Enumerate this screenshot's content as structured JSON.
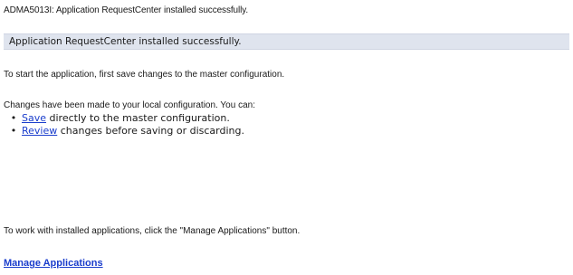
{
  "message_code_line": "ADMA5013I: Application RequestCenter installed successfully.",
  "status_banner": "Application RequestCenter installed successfully.",
  "instruction": "To start the application, first save changes to the master configuration.",
  "changes_intro": "Changes have been made to your local configuration. You can:",
  "options": [
    {
      "link_label": "Save",
      "rest": " directly to the master configuration."
    },
    {
      "link_label": "Review",
      "rest": " changes before saving or discarding."
    }
  ],
  "manage_hint": "To work with installed applications, click the \"Manage Applications\" button.",
  "manage_link": "Manage Applications",
  "colors": {
    "link": "#1a3dcc",
    "banner_background": "#dfe4ee"
  }
}
